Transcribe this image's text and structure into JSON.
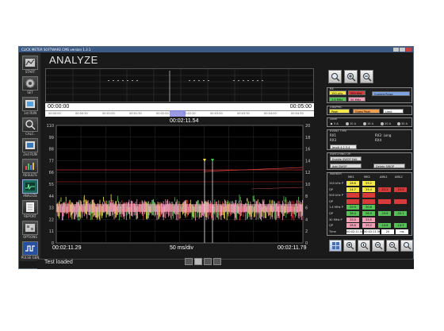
{
  "app": {
    "window_title": "CLICK METER SOFTWARE CMS version 1.3.1",
    "page_title": "ANALYZE"
  },
  "sidebar": {
    "items": [
      {
        "label": "START",
        "icon": "analyzer-icon"
      },
      {
        "label": "SET",
        "icon": "gear-icon"
      },
      {
        "label": "1st RUN",
        "icon": "run-icon"
      },
      {
        "label": "CALC.",
        "icon": "calc-icon"
      },
      {
        "label": "2nd RUN",
        "icon": "run2-icon"
      },
      {
        "label": "RESULTS",
        "icon": "results-icon"
      },
      {
        "label": "ANALYZE",
        "icon": "analyze-icon"
      },
      {
        "label": "REPORT",
        "icon": "report-icon"
      },
      {
        "label": "OPTIONS",
        "icon": "options-icon"
      },
      {
        "label": "PULSE GEN",
        "icon": "pulse-icon"
      }
    ]
  },
  "overview": {
    "start_time": "00:00:00",
    "end_time": "00:05:00",
    "ruler_labels": [
      "00:00:00",
      "00:00:30",
      "00:01:00",
      "00:01:30",
      "00:02:00",
      "00:02:30",
      "00:03:00",
      "00:03:30",
      "00:04:00",
      "00:04:30"
    ]
  },
  "main_plot": {
    "center_time": "00:02:11.54",
    "left_time": "00:02:11.29",
    "right_time": "00:02:11.79",
    "scale": "50 ms/div",
    "yticks_left": [
      "110",
      "99",
      "88",
      "77",
      "66",
      "55",
      "44",
      "33",
      "22",
      "11",
      "0"
    ],
    "yticks_right": [
      "20",
      "18",
      "16",
      "14",
      "12",
      "10",
      "8",
      "6",
      "4",
      "2",
      "0"
    ]
  },
  "status": {
    "text": "Test loaded"
  },
  "right_panel": {
    "rx_title": "RX",
    "rx_chips": {
      "a1": "150 kHz",
      "a2": "500 kHz",
      "b1": "1.4 MHz",
      "b2": "30 MHz"
    },
    "current_pulse": "Current Pulse",
    "graphic_title": "GRAPHIC",
    "graphic_chips": {
      "peak": "Peak",
      "quasi_peak": "Quasi Peak",
      "limit": "Limit"
    },
    "level_title": "Level",
    "level_options": [
      "5 A",
      "10 A",
      "15 A",
      "20 A",
      "30 A"
    ],
    "event_type_title": "EVENT TYPE",
    "event_rx1": "RX1",
    "event_rx1_val": "RX2: Long",
    "event_rx3": "RX3",
    "event_rx3_val": "RX4",
    "event_badge": "Implt 4.2.3.4",
    "switching_title": "SWITCHING OP.",
    "enable_swop": "Enable SWOP Edit",
    "add_swop": "Add SWOP",
    "delete_swop": "Delete SWOP",
    "marker_title": "MARKER",
    "marker_headers": [
      "MK1",
      "MK2",
      "ΔML1",
      "ΔML2"
    ],
    "marker_rows": [
      {
        "label": "150 kHz P",
        "values": [
          "28.6",
          "29.2",
          "",
          ""
        ]
      },
      {
        "label": "QP",
        "values": [
          "24.7",
          "25.4",
          "-21.2",
          "-21.3"
        ]
      },
      {
        "label": "500 kHz P",
        "values": [
          "",
          "",
          "",
          ""
        ]
      },
      {
        "label": "QP",
        "values": [
          "",
          "",
          "",
          ""
        ]
      },
      {
        "label": "1.4 MHz P",
        "values": [
          "29.9",
          "30.6",
          "",
          ""
        ]
      },
      {
        "label": "QP",
        "values": [
          "26.4",
          "26.9",
          "-19.6",
          "-20.1"
        ]
      },
      {
        "label": "30 MHz P",
        "values": [
          "33.0",
          "33.5",
          "",
          ""
        ]
      },
      {
        "label": "QP",
        "values": [
          "28.8",
          "29.2",
          "-14.6",
          "-14.3"
        ]
      },
      {
        "label": "Time",
        "values": [
          "00:02:11.542",
          "00:02:11.562",
          "20",
          "ms"
        ]
      }
    ],
    "colors": {
      "yellow": "#f4e84a",
      "red": "#d63a3a",
      "green": "#58c058",
      "pink": "#f2a0b8",
      "blue": "#7fa4e4",
      "white": "#ffffff"
    }
  }
}
